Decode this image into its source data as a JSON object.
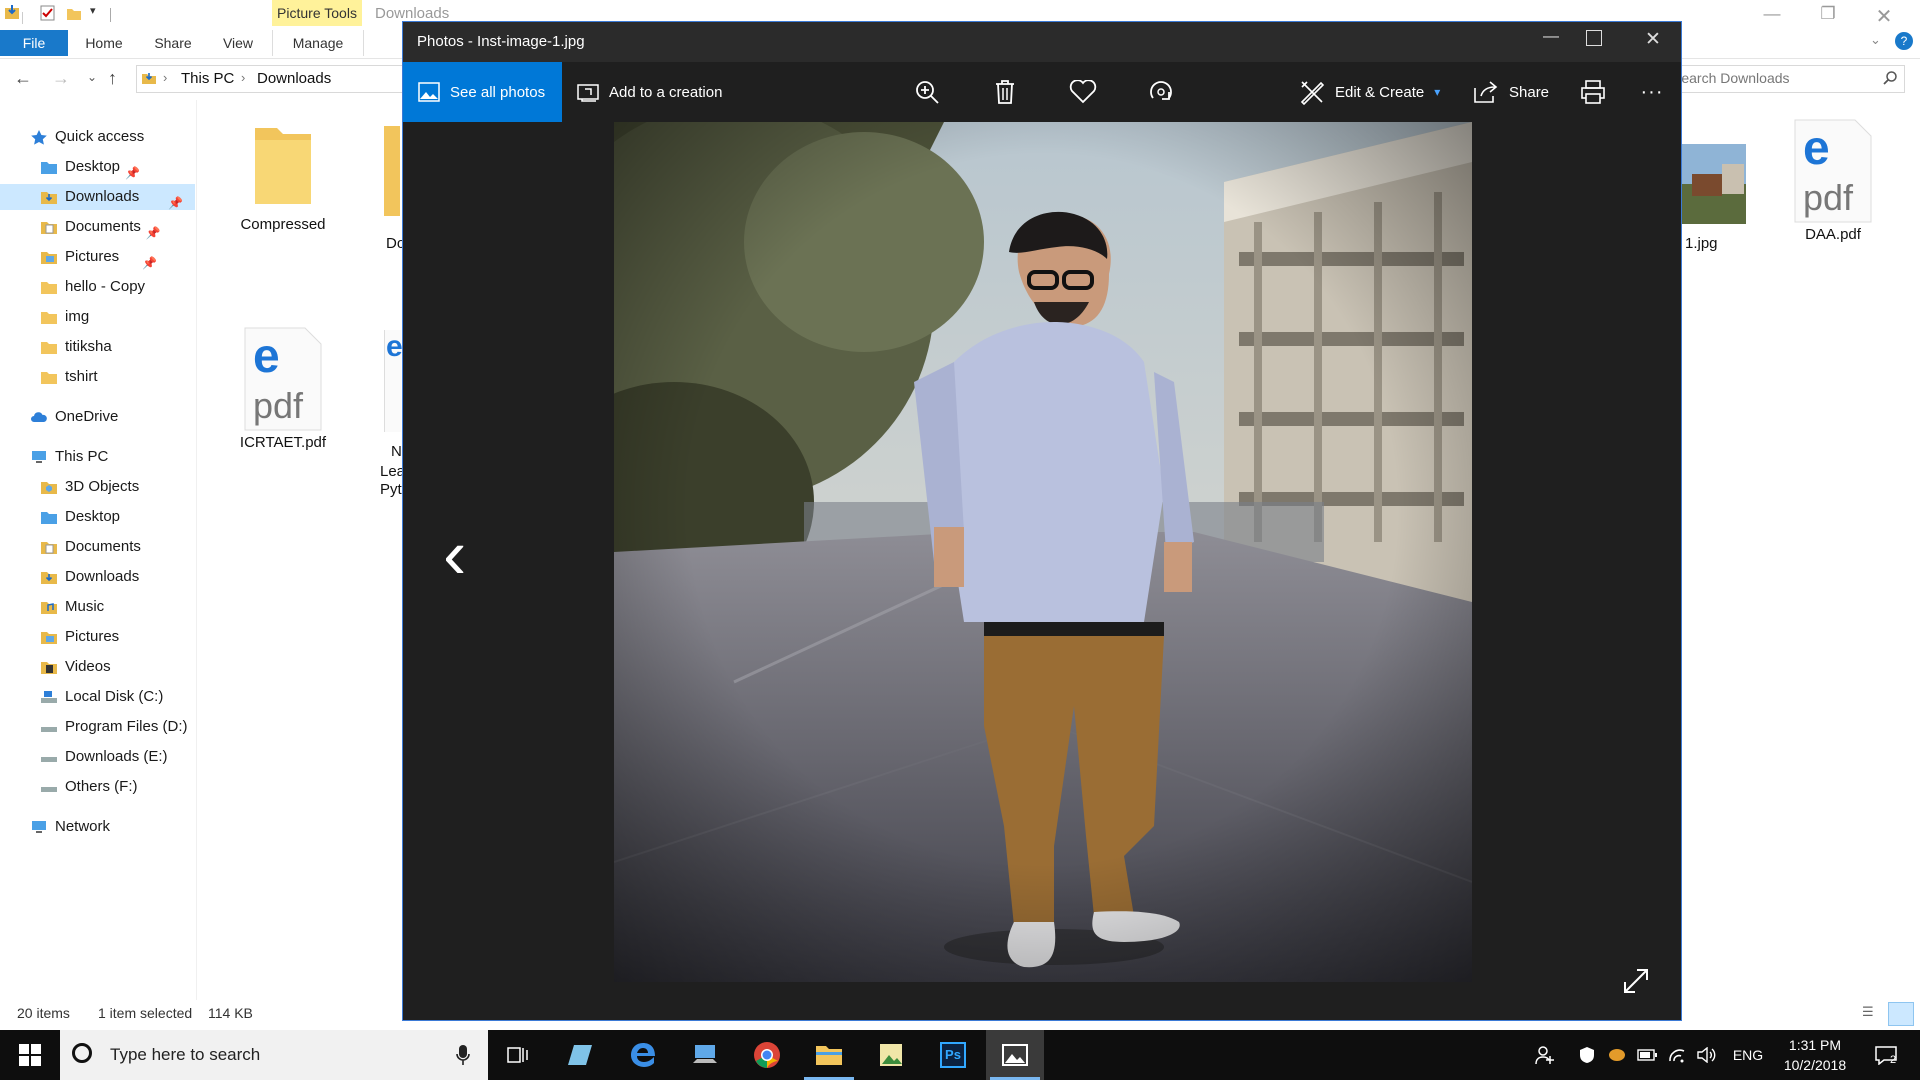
{
  "explorer": {
    "window_title": "Downloads",
    "contextual_tab": "Picture Tools",
    "tabs": [
      "File",
      "Home",
      "Share",
      "View",
      "Manage"
    ],
    "address": {
      "this_pc": "This PC",
      "current": "Downloads"
    },
    "search_placeholder": "Search Downloads",
    "nav": {
      "quick_access": "Quick access",
      "quick_items": [
        "Desktop",
        "Downloads",
        "Documents",
        "Pictures",
        "hello - Copy",
        "img",
        "titiksha",
        "tshirt"
      ],
      "onedrive": "OneDrive",
      "this_pc": "This PC",
      "pc_items": [
        "3D Objects",
        "Desktop",
        "Documents",
        "Downloads",
        "Music",
        "Pictures",
        "Videos",
        "Local Disk (C:)",
        "Program Files (D:)",
        "Downloads (E:)",
        "Others (F:)"
      ],
      "network": "Network"
    },
    "files": {
      "compressed": "Compressed",
      "do_partial": "Do",
      "icrtaet": "ICRTAET.pdf",
      "partial_line1": "N",
      "partial_line2": "Lea",
      "partial_line3": "Pyth",
      "jpg_partial": "1.jpg",
      "daa": "DAA.pdf",
      "pdf_glyph": "pdf",
      "edge_glyph": "e"
    },
    "status": {
      "items": "20 items",
      "selected": "1 item selected",
      "size": "114 KB"
    }
  },
  "photos": {
    "title": "Photos - Inst-image-1.jpg",
    "see_all": "See all photos",
    "add_creation": "Add to a creation",
    "edit_create": "Edit & Create",
    "share": "Share",
    "more": "···",
    "prev": "‹"
  },
  "taskbar": {
    "search_placeholder": "Type here to search",
    "lang": "ENG",
    "time": "1:31 PM",
    "date": "10/2/2018",
    "notifications": "2"
  },
  "colors": {
    "accent": "#0078d7",
    "file_tab": "#1979ca",
    "picture_tools": "#fff29a",
    "photos_bg": "#1f1f1f",
    "selection": "#cce8ff"
  }
}
